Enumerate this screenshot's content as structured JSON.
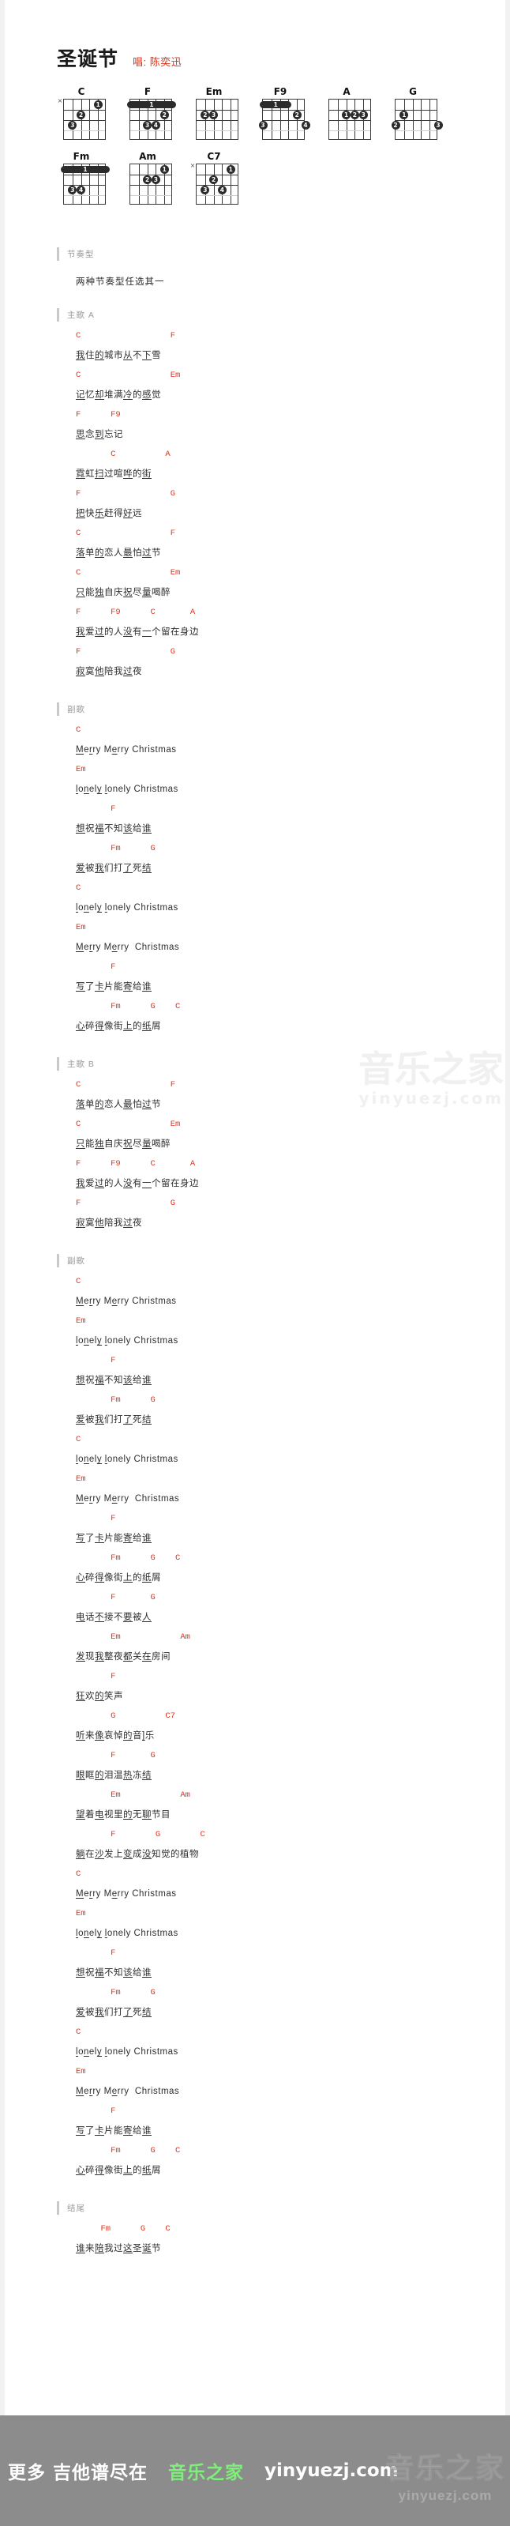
{
  "header": {
    "song_title": "圣诞节",
    "singer_label": "唱:",
    "singer_name": "陈奕迅"
  },
  "chords": {
    "row1": [
      {
        "name": "C",
        "mute": "×"
      },
      {
        "name": "F",
        "mute": ""
      },
      {
        "name": "Em",
        "mute": ""
      },
      {
        "name": "F9",
        "mute": ""
      },
      {
        "name": "A",
        "mute": ""
      },
      {
        "name": "G",
        "mute": ""
      }
    ],
    "row2": [
      {
        "name": "Fm",
        "mute": ""
      },
      {
        "name": "Am",
        "mute": ""
      },
      {
        "name": "C7",
        "mute": "×"
      }
    ]
  },
  "sections": [
    {
      "title": "节奏型",
      "note": "两种节奏型任选其一",
      "lines": []
    },
    {
      "title": "主歌 A",
      "note": "",
      "lines": [
        {
          "chords": "C                  F",
          "lyric": "我住的城市从不下雪"
        },
        {
          "chords": "C                  Em",
          "lyric": "记忆却堆满冷的感觉"
        },
        {
          "chords": "F      F9",
          "lyric": "思念到忘记"
        },
        {
          "chords": "       C          A",
          "lyric": "霓虹扫过喧哗的街"
        },
        {
          "chords": "F                  G",
          "lyric": "把快乐赶得好远"
        },
        {
          "chords": "C                  F",
          "lyric": "落单的恋人最怕过节"
        },
        {
          "chords": "C                  Em",
          "lyric": "只能独自庆祝尽量喝醉"
        },
        {
          "chords": "F      F9      C       A",
          "lyric": "我爱过的人没有一个留在身边"
        },
        {
          "chords": "F                  G",
          "lyric": "寂寞他陪我过夜"
        }
      ]
    },
    {
      "title": "副歌",
      "note": "",
      "lines": [
        {
          "chords": "C",
          "lyric": "Merry Merry Christmas"
        },
        {
          "chords": "Em",
          "lyric": "lonely lonely Christmas"
        },
        {
          "chords": "       F",
          "lyric": "想祝福不知该给谁"
        },
        {
          "chords": "       Fm      G",
          "lyric": "爱被我们打了死结"
        },
        {
          "chords": "C",
          "lyric": "lonely lonely Christmas"
        },
        {
          "chords": "Em",
          "lyric": "Merry Merry  Christmas"
        },
        {
          "chords": "       F",
          "lyric": "写了卡片能寄给谁"
        },
        {
          "chords": "       Fm      G    C",
          "lyric": "心碎得像街上的纸屑"
        }
      ]
    },
    {
      "title": "主歌 B",
      "note": "",
      "lines": [
        {
          "chords": "C                  F",
          "lyric": "落单的恋人最怕过节"
        },
        {
          "chords": "C                  Em",
          "lyric": "只能独自庆祝尽量喝醉"
        },
        {
          "chords": "F      F9      C       A",
          "lyric": "我爱过的人没有一个留在身边"
        },
        {
          "chords": "F                  G",
          "lyric": "寂寞他陪我过夜"
        }
      ]
    },
    {
      "title": "副歌",
      "note": "",
      "lines": [
        {
          "chords": "C",
          "lyric": "Merry Merry Christmas"
        },
        {
          "chords": "Em",
          "lyric": "lonely lonely Christmas"
        },
        {
          "chords": "       F",
          "lyric": "想祝福不知该给谁"
        },
        {
          "chords": "       Fm      G",
          "lyric": "爱被我们打了死结"
        },
        {
          "chords": "C",
          "lyric": "lonely lonely Christmas"
        },
        {
          "chords": "Em",
          "lyric": "Merry Merry  Christmas"
        },
        {
          "chords": "       F",
          "lyric": "写了卡片能寄给谁"
        },
        {
          "chords": "       Fm      G    C",
          "lyric": "心碎得像街上的纸屑"
        },
        {
          "chords": "       F       G",
          "lyric": "电话不接不要被人"
        },
        {
          "chords": "       Em            Am",
          "lyric": "发现我整夜都关在房间"
        },
        {
          "chords": "       F",
          "lyric": "狂欢的笑声"
        },
        {
          "chords": "       G          C7",
          "lyric": "听来像哀悼的音]乐"
        },
        {
          "chords": "       F       G",
          "lyric": "眼眶的泪温热冻结"
        },
        {
          "chords": "       Em            Am",
          "lyric": "望着电视里的无聊节目"
        },
        {
          "chords": "       F        G        C",
          "lyric": "躺在沙发上变成没知觉的植物"
        },
        {
          "chords": "C",
          "lyric": "Merry Merry Christmas"
        },
        {
          "chords": "Em",
          "lyric": "lonely lonely Christmas"
        },
        {
          "chords": "       F",
          "lyric": "想祝福不知该给谁"
        },
        {
          "chords": "       Fm      G",
          "lyric": "爱被我们打了死结"
        },
        {
          "chords": "C",
          "lyric": "lonely lonely Christmas"
        },
        {
          "chords": "Em",
          "lyric": "Merry Merry  Christmas"
        },
        {
          "chords": "       F",
          "lyric": "写了卡片能寄给谁"
        },
        {
          "chords": "       Fm      G    C",
          "lyric": "心碎得像街上的纸屑"
        }
      ]
    },
    {
      "title": "结尾",
      "note": "",
      "lines": [
        {
          "chords": "     Fm      G    C",
          "lyric": "谁来陪我过这圣诞节"
        }
      ]
    }
  ],
  "watermark": {
    "brand": "音乐之家",
    "url": "yinyuezj.com"
  },
  "footer": {
    "more_text": "更多 吉他谱尽在",
    "brand": "音乐之家",
    "url": "yinyuezj.com",
    "stamp_brand": "音乐之家",
    "stamp_url": "yinyuezj.com"
  },
  "colors": {
    "chord_red": "#e2331c",
    "singer_red": "#d8341c",
    "footer_bg": "#8c8c8c",
    "brand_green": "#7ef07a"
  }
}
